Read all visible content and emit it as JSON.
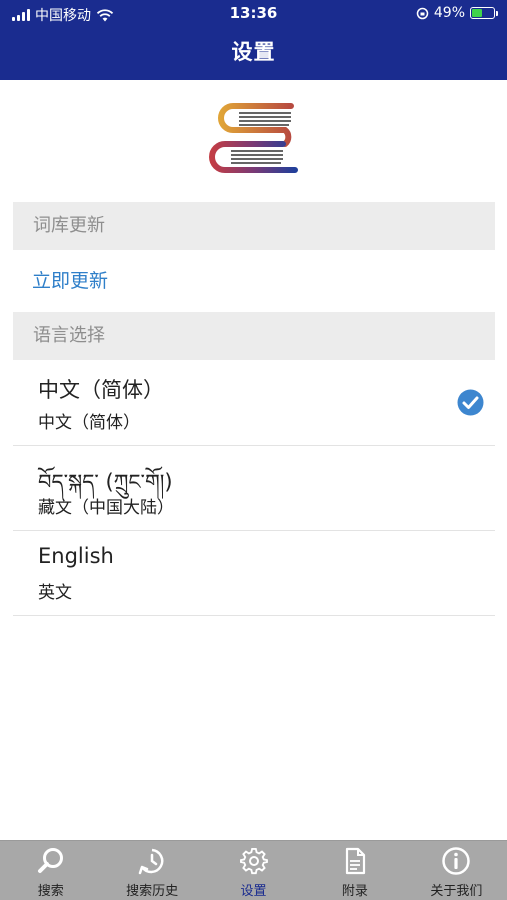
{
  "status_bar": {
    "carrier": "中国移动",
    "time": "13:36",
    "battery_text": "49%",
    "battery_level": 0.49
  },
  "nav": {
    "title": "设置"
  },
  "sections": {
    "update_header": "词库更新",
    "update_now": "立即更新",
    "language_header": "语言选择"
  },
  "languages": [
    {
      "name": "中文（简体）",
      "subtitle": "中文（简体）",
      "selected": true
    },
    {
      "name": "བོད་སྐད་ (ཀྲུང་གོ།)",
      "subtitle": "藏文（中国大陆）",
      "selected": false
    },
    {
      "name": "English",
      "subtitle": "英文",
      "selected": false
    }
  ],
  "tabs": [
    {
      "label": "搜索",
      "icon": "search-icon"
    },
    {
      "label": "搜索历史",
      "icon": "history-icon"
    },
    {
      "label": "设置",
      "icon": "gear-icon",
      "active": true
    },
    {
      "label": "附录",
      "icon": "document-icon"
    },
    {
      "label": "关于我们",
      "icon": "info-icon"
    }
  ],
  "colors": {
    "nav_bar": "#1a2c8f",
    "link": "#2f7fc9",
    "check": "#3d86cf",
    "tab_bar": "#a8a8a8"
  }
}
